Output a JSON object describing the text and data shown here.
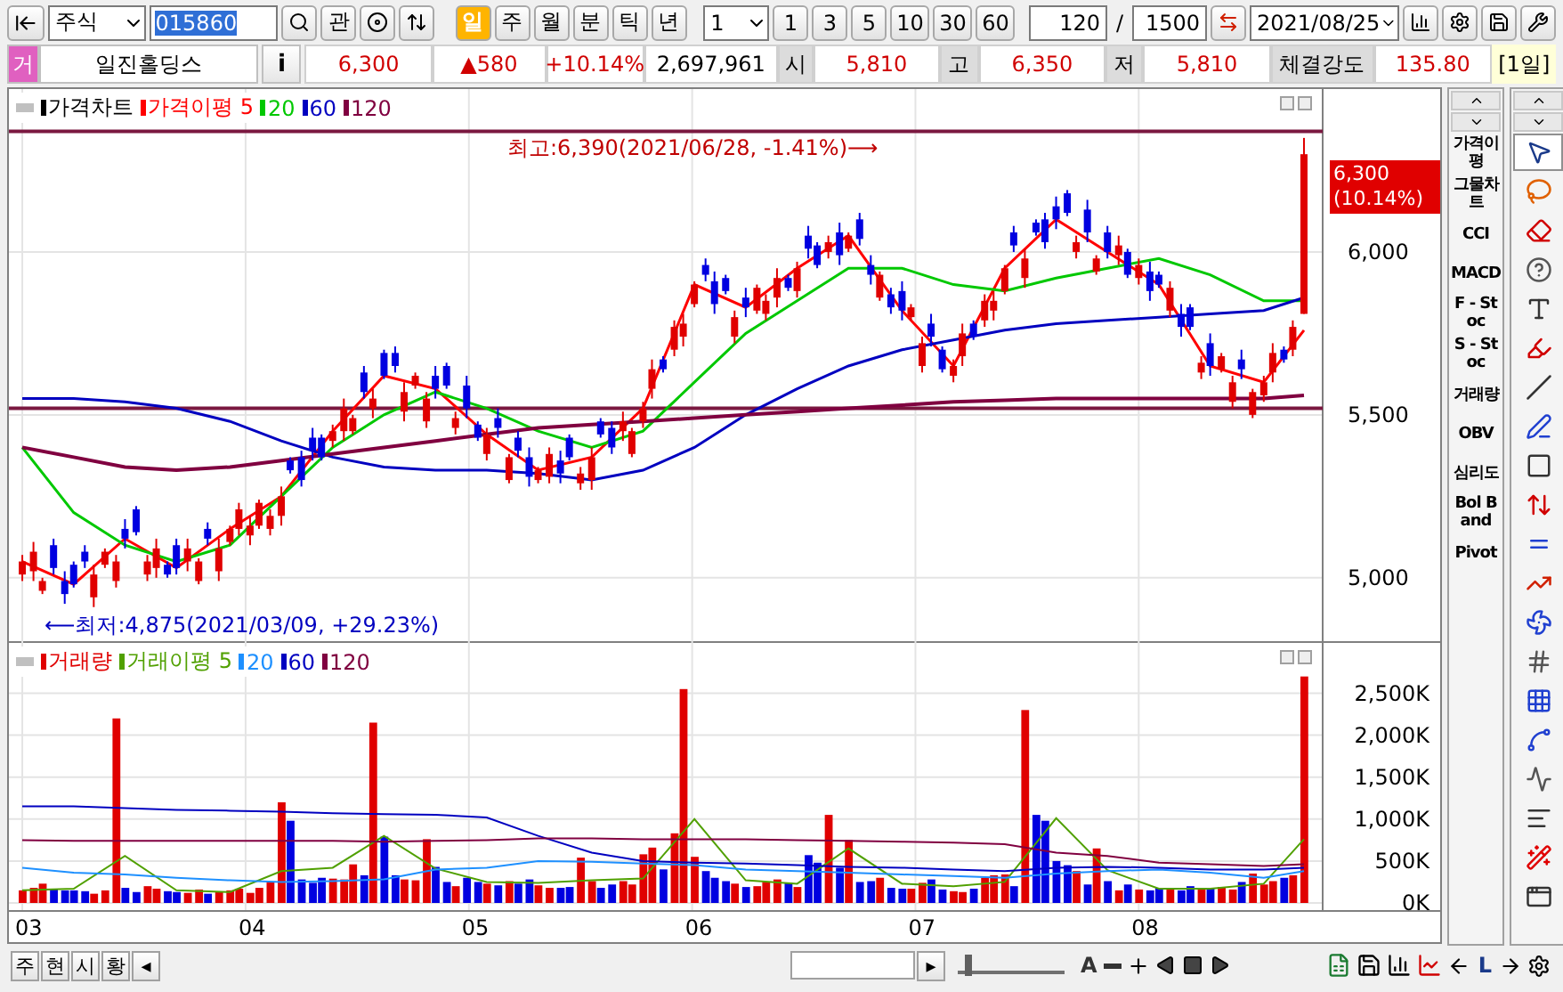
{
  "toolbar": {
    "market": "주식",
    "code": "015860",
    "watch": "관",
    "periods": [
      {
        "label": "일",
        "selected": true
      },
      {
        "label": "주",
        "selected": false
      },
      {
        "label": "월",
        "selected": false
      },
      {
        "label": "분",
        "selected": false
      },
      {
        "label": "틱",
        "selected": false
      },
      {
        "label": "년",
        "selected": false
      }
    ],
    "minute": "1",
    "intervals": [
      "1",
      "3",
      "5",
      "10",
      "30",
      "60"
    ],
    "count": "120",
    "divider": "/",
    "total": "1500",
    "date": "2021/08/25"
  },
  "quote": {
    "badge": "거",
    "name": "일진홀딩스",
    "info": "i",
    "price": "6,300",
    "change": "▲580",
    "rate": "+10.14%",
    "volume": "2,697,961",
    "fields": [
      {
        "label": "시",
        "value": "5,810"
      },
      {
        "label": "고",
        "value": "6,350"
      },
      {
        "label": "저",
        "value": "5,810"
      },
      {
        "label": "체결강도",
        "value": "135.80"
      }
    ],
    "period": "[1일]"
  },
  "price_chart": {
    "candles_label": "가격차트",
    "price_tag": {
      "value": "6,300",
      "rate": "(10.14%)"
    },
    "chart_data": {
      "type": "candlestick",
      "grid": true,
      "xlim": [
        2.94,
        9.35
      ],
      "ylim": [
        4800,
        6500
      ],
      "yticks": [
        {
          "value": 5000,
          "label": "5,000"
        },
        {
          "value": 5500,
          "label": "5,500"
        },
        {
          "value": 6000,
          "label": "6,000"
        }
      ],
      "x": [
        3,
        3.05,
        3.09,
        3.14,
        3.19,
        3.23,
        3.28,
        3.32,
        3.37,
        3.42,
        3.46,
        3.51,
        3.56,
        3.6,
        3.65,
        3.69,
        3.74,
        3.79,
        3.83,
        3.88,
        3.93,
        3.97,
        4.02,
        4.06,
        4.11,
        4.16,
        4.2,
        4.25,
        4.3,
        4.34,
        4.39,
        4.44,
        4.48,
        4.53,
        4.57,
        4.62,
        4.67,
        4.71,
        4.76,
        4.81,
        4.85,
        4.9,
        4.94,
        4.99,
        5.04,
        5.08,
        5.13,
        5.18,
        5.22,
        5.27,
        5.31,
        5.36,
        5.41,
        5.45,
        5.5,
        5.55,
        5.59,
        5.64,
        5.69,
        5.73,
        5.78,
        5.82,
        5.87,
        5.92,
        5.96,
        6.01,
        6.06,
        6.1,
        6.15,
        6.19,
        6.24,
        6.29,
        6.33,
        6.38,
        6.43,
        6.47,
        6.52,
        6.56,
        6.61,
        6.66,
        6.7,
        6.75,
        6.8,
        6.84,
        6.89,
        6.94,
        6.98,
        7.03,
        7.07,
        7.12,
        7.17,
        7.21,
        7.26,
        7.31,
        7.35,
        7.4,
        7.44,
        7.49,
        7.54,
        7.58,
        7.63,
        7.68,
        7.72,
        7.77,
        7.81,
        7.86,
        7.91,
        7.95,
        8,
        8.05,
        8.09,
        8.14,
        8.19,
        8.23,
        8.28,
        8.32,
        8.37,
        8.42,
        8.46,
        8.51,
        8.56,
        8.6,
        8.65,
        8.69,
        8.74
      ],
      "ohlc": [
        [
          5010,
          5070,
          4990,
          5050
        ],
        [
          5020,
          5110,
          4990,
          5080
        ],
        [
          4960,
          5000,
          4950,
          4990
        ],
        [
          5100,
          5120,
          5010,
          5030
        ],
        [
          4990,
          5020,
          4920,
          4950
        ],
        [
          5040,
          5050,
          4970,
          4980
        ],
        [
          5080,
          5100,
          5030,
          5050
        ],
        [
          4940,
          5040,
          4910,
          5010
        ],
        [
          5040,
          5090,
          5030,
          5080
        ],
        [
          4990,
          5070,
          4970,
          5050
        ],
        [
          5150,
          5180,
          5090,
          5120
        ],
        [
          5210,
          5220,
          5130,
          5140
        ],
        [
          5010,
          5070,
          4990,
          5050
        ],
        [
          5030,
          5120,
          5000,
          5090
        ],
        [
          5040,
          5050,
          5000,
          5010
        ],
        [
          5100,
          5120,
          5010,
          5030
        ],
        [
          5050,
          5120,
          5020,
          5090
        ],
        [
          4990,
          5060,
          4980,
          5050
        ],
        [
          5150,
          5170,
          5100,
          5120
        ],
        [
          5020,
          5120,
          4990,
          5090
        ],
        [
          5110,
          5160,
          5100,
          5150
        ],
        [
          5150,
          5230,
          5130,
          5210
        ],
        [
          5130,
          5190,
          5100,
          5160
        ],
        [
          5160,
          5240,
          5150,
          5230
        ],
        [
          5150,
          5210,
          5130,
          5190
        ],
        [
          5190,
          5280,
          5160,
          5250
        ],
        [
          5360,
          5370,
          5320,
          5330
        ],
        [
          5370,
          5390,
          5280,
          5300
        ],
        [
          5430,
          5460,
          5360,
          5390
        ],
        [
          5430,
          5440,
          5360,
          5370
        ],
        [
          5420,
          5470,
          5400,
          5450
        ],
        [
          5450,
          5550,
          5420,
          5520
        ],
        [
          5450,
          5500,
          5440,
          5490
        ],
        [
          5630,
          5650,
          5550,
          5570
        ],
        [
          5520,
          5580,
          5490,
          5550
        ],
        [
          5690,
          5700,
          5610,
          5620
        ],
        [
          5690,
          5710,
          5630,
          5650
        ],
        [
          5510,
          5600,
          5480,
          5570
        ],
        [
          5590,
          5630,
          5580,
          5620
        ],
        [
          5480,
          5570,
          5460,
          5550
        ],
        [
          5620,
          5650,
          5550,
          5580
        ],
        [
          5650,
          5660,
          5580,
          5590
        ],
        [
          5460,
          5510,
          5440,
          5490
        ],
        [
          5590,
          5620,
          5490,
          5520
        ],
        [
          5470,
          5480,
          5420,
          5430
        ],
        [
          5380,
          5460,
          5360,
          5440
        ],
        [
          5490,
          5520,
          5430,
          5460
        ],
        [
          5300,
          5380,
          5290,
          5370
        ],
        [
          5430,
          5450,
          5370,
          5390
        ],
        [
          5370,
          5400,
          5280,
          5310
        ],
        [
          5300,
          5340,
          5290,
          5330
        ],
        [
          5310,
          5400,
          5290,
          5380
        ],
        [
          5360,
          5390,
          5290,
          5320
        ],
        [
          5430,
          5440,
          5360,
          5370
        ],
        [
          5290,
          5340,
          5270,
          5320
        ],
        [
          5300,
          5400,
          5270,
          5370
        ],
        [
          5480,
          5490,
          5430,
          5440
        ],
        [
          5460,
          5480,
          5380,
          5400
        ],
        [
          5450,
          5510,
          5420,
          5480
        ],
        [
          5380,
          5460,
          5370,
          5450
        ],
        [
          5480,
          5540,
          5460,
          5520
        ],
        [
          5580,
          5670,
          5550,
          5640
        ],
        [
          5670,
          5680,
          5630,
          5640
        ],
        [
          5700,
          5790,
          5680,
          5770
        ],
        [
          5740,
          5810,
          5710,
          5780
        ],
        [
          5840,
          5910,
          5830,
          5900
        ],
        [
          5960,
          5980,
          5910,
          5930
        ],
        [
          5910,
          5940,
          5810,
          5840
        ],
        [
          5920,
          5930,
          5870,
          5880
        ],
        [
          5740,
          5820,
          5720,
          5800
        ],
        [
          5860,
          5890,
          5800,
          5830
        ],
        [
          5820,
          5900,
          5810,
          5890
        ],
        [
          5810,
          5870,
          5790,
          5850
        ],
        [
          5860,
          5950,
          5830,
          5920
        ],
        [
          5920,
          5930,
          5880,
          5890
        ],
        [
          5880,
          5970,
          5860,
          5950
        ],
        [
          6050,
          6080,
          5980,
          6010
        ],
        [
          6020,
          6030,
          5950,
          5960
        ],
        [
          6000,
          6050,
          5980,
          6030
        ],
        [
          6060,
          6090,
          5960,
          5990
        ],
        [
          6010,
          6060,
          6000,
          6050
        ],
        [
          6100,
          6120,
          6020,
          6040
        ],
        [
          5960,
          5990,
          5900,
          5930
        ],
        [
          5860,
          5940,
          5850,
          5930
        ],
        [
          5870,
          5890,
          5810,
          5830
        ],
        [
          5880,
          5910,
          5790,
          5820
        ],
        [
          5800,
          5840,
          5790,
          5830
        ],
        [
          5650,
          5740,
          5630,
          5720
        ],
        [
          5780,
          5810,
          5710,
          5740
        ],
        [
          5700,
          5710,
          5630,
          5640
        ],
        [
          5620,
          5670,
          5600,
          5650
        ],
        [
          5680,
          5780,
          5650,
          5750
        ],
        [
          5780,
          5790,
          5730,
          5740
        ],
        [
          5790,
          5870,
          5770,
          5850
        ],
        [
          5820,
          5880,
          5790,
          5850
        ],
        [
          5880,
          5960,
          5870,
          5950
        ],
        [
          6060,
          6080,
          6000,
          6020
        ],
        [
          5920,
          6010,
          5890,
          5980
        ],
        [
          6090,
          6100,
          6050,
          6060
        ],
        [
          6100,
          6120,
          6010,
          6030
        ],
        [
          6140,
          6170,
          6070,
          6100
        ],
        [
          6180,
          6190,
          6110,
          6120
        ],
        [
          6000,
          6050,
          5980,
          6030
        ],
        [
          6130,
          6160,
          6030,
          6060
        ],
        [
          5940,
          5990,
          5930,
          5980
        ],
        [
          6060,
          6080,
          5980,
          6000
        ],
        [
          5990,
          6050,
          5960,
          6020
        ],
        [
          6000,
          6010,
          5920,
          5930
        ],
        [
          5920,
          5980,
          5900,
          5960
        ],
        [
          5940,
          5970,
          5850,
          5880
        ],
        [
          5930,
          5940,
          5890,
          5900
        ],
        [
          5820,
          5910,
          5800,
          5890
        ],
        [
          5810,
          5840,
          5740,
          5770
        ],
        [
          5830,
          5840,
          5760,
          5770
        ],
        [
          5630,
          5680,
          5610,
          5660
        ],
        [
          5720,
          5750,
          5620,
          5650
        ],
        [
          5640,
          5690,
          5630,
          5680
        ],
        [
          5540,
          5620,
          5520,
          5600
        ],
        [
          5670,
          5700,
          5610,
          5640
        ],
        [
          5500,
          5580,
          5490,
          5570
        ],
        [
          5560,
          5620,
          5540,
          5600
        ],
        [
          5630,
          5720,
          5600,
          5690
        ],
        [
          5700,
          5710,
          5660,
          5670
        ],
        [
          5700,
          5790,
          5680,
          5770
        ],
        [
          5810,
          6350,
          5810,
          6300
        ]
      ],
      "series": [
        {
          "name": "가격이평 5",
          "type": "line",
          "color": "#ff0000",
          "x": [
            3,
            3.23,
            3.46,
            3.69,
            3.93,
            4.16,
            4.39,
            4.62,
            4.85,
            5.08,
            5.31,
            5.55,
            5.78,
            6.01,
            6.24,
            6.47,
            6.7,
            6.94,
            7.17,
            7.4,
            7.63,
            7.86,
            8.09,
            8.32,
            8.56,
            8.74
          ],
          "values": [
            5050,
            4980,
            5120,
            5030,
            5150,
            5250,
            5450,
            5620,
            5580,
            5440,
            5330,
            5370,
            5520,
            5900,
            5830,
            5950,
            6050,
            5820,
            5650,
            5950,
            6100,
            6000,
            5900,
            5650,
            5600,
            5760
          ]
        },
        {
          "name": "20",
          "type": "line",
          "color": "#00c800",
          "x": [
            3,
            3.23,
            3.46,
            3.69,
            3.93,
            4.16,
            4.39,
            4.62,
            4.85,
            5.08,
            5.31,
            5.55,
            5.78,
            6.01,
            6.24,
            6.47,
            6.7,
            6.94,
            7.17,
            7.4,
            7.63,
            7.86,
            8.09,
            8.32,
            8.56,
            8.74
          ],
          "values": [
            5400,
            5200,
            5100,
            5050,
            5100,
            5250,
            5400,
            5500,
            5570,
            5520,
            5450,
            5400,
            5450,
            5600,
            5750,
            5850,
            5950,
            5950,
            5900,
            5880,
            5920,
            5950,
            5980,
            5930,
            5850,
            5850
          ]
        },
        {
          "name": "60",
          "type": "line",
          "color": "#0000c0",
          "x": [
            3,
            3.23,
            3.46,
            3.69,
            3.93,
            4.16,
            4.39,
            4.62,
            4.85,
            5.08,
            5.31,
            5.55,
            5.78,
            6.01,
            6.24,
            6.47,
            6.7,
            6.94,
            7.17,
            7.4,
            7.63,
            7.86,
            8.09,
            8.32,
            8.56,
            8.74
          ],
          "values": [
            5550,
            5550,
            5540,
            5520,
            5480,
            5420,
            5370,
            5340,
            5330,
            5330,
            5320,
            5300,
            5330,
            5400,
            5500,
            5580,
            5650,
            5700,
            5730,
            5760,
            5780,
            5790,
            5800,
            5810,
            5820,
            5860
          ]
        },
        {
          "name": "120",
          "type": "line",
          "color": "#800040",
          "x": [
            3,
            3.23,
            3.46,
            3.69,
            3.93,
            4.16,
            4.39,
            4.62,
            4.85,
            5.08,
            5.31,
            5.55,
            5.78,
            6.01,
            6.24,
            6.47,
            6.7,
            6.94,
            7.17,
            7.4,
            7.63,
            7.86,
            8.09,
            8.32,
            8.56,
            8.74
          ],
          "values": [
            5400,
            5370,
            5340,
            5330,
            5340,
            5360,
            5380,
            5400,
            5420,
            5440,
            5460,
            5470,
            5480,
            5490,
            5500,
            5510,
            5520,
            5530,
            5540,
            5545,
            5550,
            5550,
            5550,
            5550,
            5550,
            5560
          ]
        }
      ],
      "ref_lines": [
        {
          "axis": "y",
          "value": 6370,
          "color": "#7a1840"
        },
        {
          "axis": "y",
          "value": 5520,
          "color": "#7a1840"
        }
      ],
      "annotations": [
        {
          "text": "최고:6,390(2021/06/28, -1.41%)⟶"
        },
        {
          "text": "⟵최저:4,875(2021/03/09, +29.23%)"
        }
      ]
    }
  },
  "volume_chart": {
    "chart_data": {
      "type": "bar",
      "grid": true,
      "xlim": [
        2.94,
        9.35
      ],
      "ylim": [
        0,
        3100
      ],
      "yticks": [
        {
          "value": 0,
          "label": "0K"
        },
        {
          "value": 500,
          "label": "500K"
        },
        {
          "value": 1000,
          "label": "1,000K"
        },
        {
          "value": 1500,
          "label": "1,500K"
        },
        {
          "value": 2000,
          "label": "2,000K"
        },
        {
          "value": 2500,
          "label": "2,500K"
        }
      ],
      "x": [
        3,
        3.05,
        3.09,
        3.14,
        3.19,
        3.23,
        3.28,
        3.32,
        3.37,
        3.42,
        3.46,
        3.51,
        3.56,
        3.6,
        3.65,
        3.69,
        3.74,
        3.79,
        3.83,
        3.88,
        3.93,
        3.97,
        4.02,
        4.06,
        4.11,
        4.16,
        4.2,
        4.25,
        4.3,
        4.34,
        4.39,
        4.44,
        4.48,
        4.53,
        4.57,
        4.62,
        4.67,
        4.71,
        4.76,
        4.81,
        4.85,
        4.9,
        4.94,
        4.99,
        5.04,
        5.08,
        5.13,
        5.18,
        5.22,
        5.27,
        5.31,
        5.36,
        5.41,
        5.45,
        5.5,
        5.55,
        5.59,
        5.64,
        5.69,
        5.73,
        5.78,
        5.82,
        5.87,
        5.92,
        5.96,
        6.01,
        6.06,
        6.1,
        6.15,
        6.19,
        6.24,
        6.29,
        6.33,
        6.38,
        6.43,
        6.47,
        6.52,
        6.56,
        6.61,
        6.66,
        6.7,
        6.75,
        6.8,
        6.84,
        6.89,
        6.94,
        6.98,
        7.03,
        7.07,
        7.12,
        7.17,
        7.21,
        7.26,
        7.31,
        7.35,
        7.4,
        7.44,
        7.49,
        7.54,
        7.58,
        7.63,
        7.68,
        7.72,
        7.77,
        7.81,
        7.86,
        7.91,
        7.95,
        8,
        8.05,
        8.09,
        8.14,
        8.19,
        8.23,
        8.28,
        8.32,
        8.37,
        8.42,
        8.46,
        8.51,
        8.56,
        8.6,
        8.65,
        8.69,
        8.74
      ],
      "xticks": [
        {
          "value": 3,
          "label": "03"
        },
        {
          "value": 4,
          "label": "04"
        },
        {
          "value": 5,
          "label": "05"
        },
        {
          "value": 6,
          "label": "06"
        },
        {
          "value": 7,
          "label": "07"
        },
        {
          "value": 8,
          "label": "08"
        }
      ],
      "series": [
        {
          "name": "거래량",
          "color": "#e00000",
          "values": [
            150,
            180,
            230,
            null,
            null,
            null,
            null,
            110,
            150,
            2200,
            null,
            null,
            200,
            170,
            null,
            null,
            120,
            160,
            null,
            130,
            150,
            170,
            120,
            180,
            250,
            1200,
            null,
            null,
            null,
            null,
            290,
            280,
            460,
            null,
            2150,
            null,
            null,
            280,
            270,
            760,
            null,
            null,
            200,
            null,
            null,
            230,
            null,
            260,
            null,
            null,
            210,
            180,
            null,
            null,
            540,
            260,
            null,
            null,
            260,
            220,
            580,
            660,
            null,
            830,
            2550,
            550,
            null,
            null,
            null,
            230,
            null,
            200,
            250,
            280,
            null,
            190,
            null,
            null,
            1050,
            null,
            750,
            null,
            null,
            300,
            null,
            null,
            170,
            240,
            null,
            null,
            140,
            130,
            null,
            300,
            330,
            340,
            null,
            2300,
            null,
            null,
            null,
            null,
            380,
            null,
            650,
            null,
            150,
            null,
            160,
            null,
            null,
            160,
            null,
            null,
            180,
            null,
            190,
            160,
            null,
            350,
            220,
            260,
            null,
            330,
            2700
          ]
        },
        {
          "color": "#0000e0",
          "values": [
            null,
            null,
            null,
            160,
            150,
            150,
            140,
            null,
            null,
            null,
            180,
            130,
            null,
            null,
            140,
            130,
            null,
            null,
            110,
            null,
            null,
            null,
            null,
            null,
            null,
            null,
            980,
            280,
            240,
            300,
            null,
            null,
            null,
            330,
            null,
            790,
            330,
            null,
            null,
            null,
            430,
            250,
            null,
            300,
            250,
            null,
            210,
            null,
            230,
            280,
            null,
            null,
            180,
            190,
            null,
            null,
            180,
            220,
            null,
            null,
            null,
            null,
            400,
            null,
            null,
            null,
            380,
            300,
            260,
            null,
            190,
            null,
            null,
            null,
            240,
            null,
            570,
            480,
            null,
            420,
            null,
            250,
            260,
            null,
            180,
            170,
            null,
            null,
            280,
            160,
            null,
            null,
            170,
            null,
            null,
            null,
            200,
            null,
            1050,
            980,
            500,
            450,
            null,
            220,
            null,
            260,
            null,
            220,
            null,
            150,
            180,
            null,
            150,
            200,
            null,
            170,
            null,
            null,
            250,
            null,
            null,
            null,
            300,
            null,
            null
          ]
        },
        {
          "name": "거래이평 5",
          "type": "line",
          "color": "#50a000",
          "x": [
            3,
            3.23,
            3.46,
            3.69,
            3.93,
            4.16,
            4.39,
            4.62,
            4.85,
            5.08,
            5.31,
            5.55,
            5.78,
            6.01,
            6.24,
            6.47,
            6.7,
            6.94,
            7.17,
            7.4,
            7.63,
            7.86,
            8.09,
            8.32,
            8.56,
            8.74
          ],
          "values": [
            150,
            170,
            560,
            150,
            130,
            380,
            420,
            800,
            410,
            250,
            240,
            270,
            290,
            1000,
            270,
            230,
            650,
            230,
            200,
            250,
            1010,
            390,
            170,
            170,
            230,
            760
          ]
        },
        {
          "name": "20",
          "type": "line",
          "color": "#1e90ff",
          "x": [
            3,
            3.23,
            3.46,
            3.69,
            3.93,
            4.16,
            4.39,
            4.62,
            4.85,
            5.08,
            5.31,
            5.55,
            5.78,
            6.01,
            6.24,
            6.47,
            6.7,
            6.94,
            7.17,
            7.4,
            7.63,
            7.86,
            8.09,
            8.32,
            8.56,
            8.74
          ],
          "values": [
            420,
            360,
            340,
            300,
            270,
            250,
            260,
            280,
            400,
            420,
            500,
            490,
            470,
            450,
            400,
            380,
            360,
            340,
            320,
            300,
            350,
            380,
            400,
            360,
            300,
            380
          ]
        },
        {
          "name": "60",
          "type": "line",
          "color": "#0000c0",
          "x": [
            3,
            3.23,
            3.46,
            3.69,
            3.93,
            4.16,
            4.39,
            4.62,
            4.85,
            5.08,
            5.31,
            5.55,
            5.78,
            6.01,
            6.24,
            6.47,
            6.7,
            6.94,
            7.17,
            7.4,
            7.63,
            7.86,
            8.09,
            8.32,
            8.56,
            8.74
          ],
          "values": [
            1150,
            1150,
            1130,
            1110,
            1100,
            1090,
            1070,
            1060,
            1050,
            1020,
            800,
            600,
            500,
            480,
            470,
            450,
            430,
            420,
            400,
            380,
            420,
            430,
            420,
            400,
            400,
            420
          ]
        },
        {
          "name": "120",
          "type": "line",
          "color": "#800040",
          "x": [
            3,
            3.23,
            3.46,
            3.69,
            3.93,
            4.16,
            4.39,
            4.62,
            4.85,
            5.08,
            5.31,
            5.55,
            5.78,
            6.01,
            6.24,
            6.47,
            6.7,
            6.94,
            7.17,
            7.4,
            7.63,
            7.86,
            8.09,
            8.32,
            8.56,
            8.74
          ],
          "values": [
            750,
            740,
            740,
            740,
            740,
            740,
            740,
            730,
            740,
            750,
            770,
            770,
            760,
            760,
            760,
            750,
            740,
            730,
            720,
            700,
            600,
            560,
            480,
            460,
            440,
            460
          ]
        }
      ]
    }
  },
  "indicators": [
    "가격이평",
    "그물차트",
    "CCI",
    "MACD",
    "F - Stoc",
    "S - Stoc",
    "거래량",
    "OBV",
    "심리도",
    "Bol Band",
    "Pivot"
  ],
  "tools": [
    {
      "kind": "pointer",
      "selected": true
    },
    {
      "kind": "lasso",
      "selected": false
    },
    {
      "kind": "erase-all",
      "selected": false
    },
    {
      "kind": "help",
      "selected": false
    },
    {
      "kind": "text",
      "selected": false
    },
    {
      "kind": "highlight",
      "selected": false
    },
    {
      "kind": "line",
      "selected": false
    },
    {
      "kind": "pen",
      "selected": false
    },
    {
      "kind": "rectangle",
      "selected": false
    },
    {
      "kind": "arrows",
      "selected": false
    },
    {
      "kind": "levels",
      "selected": false
    },
    {
      "kind": "trend",
      "selected": false
    },
    {
      "kind": "fan",
      "selected": false
    },
    {
      "kind": "hatch",
      "selected": false
    },
    {
      "kind": "grid",
      "selected": false
    },
    {
      "kind": "spline",
      "selected": false
    },
    {
      "kind": "wave",
      "selected": false
    },
    {
      "kind": "lines",
      "selected": false
    },
    {
      "kind": "auto",
      "selected": false
    },
    {
      "kind": "window",
      "selected": false
    }
  ],
  "bottom_bar": {
    "tabs": [
      "주",
      "현",
      "시",
      "황"
    ],
    "prev": "◂",
    "next": "▸",
    "slider": {
      "level": 0.06
    },
    "font_key": "A",
    "line_key": "L"
  }
}
